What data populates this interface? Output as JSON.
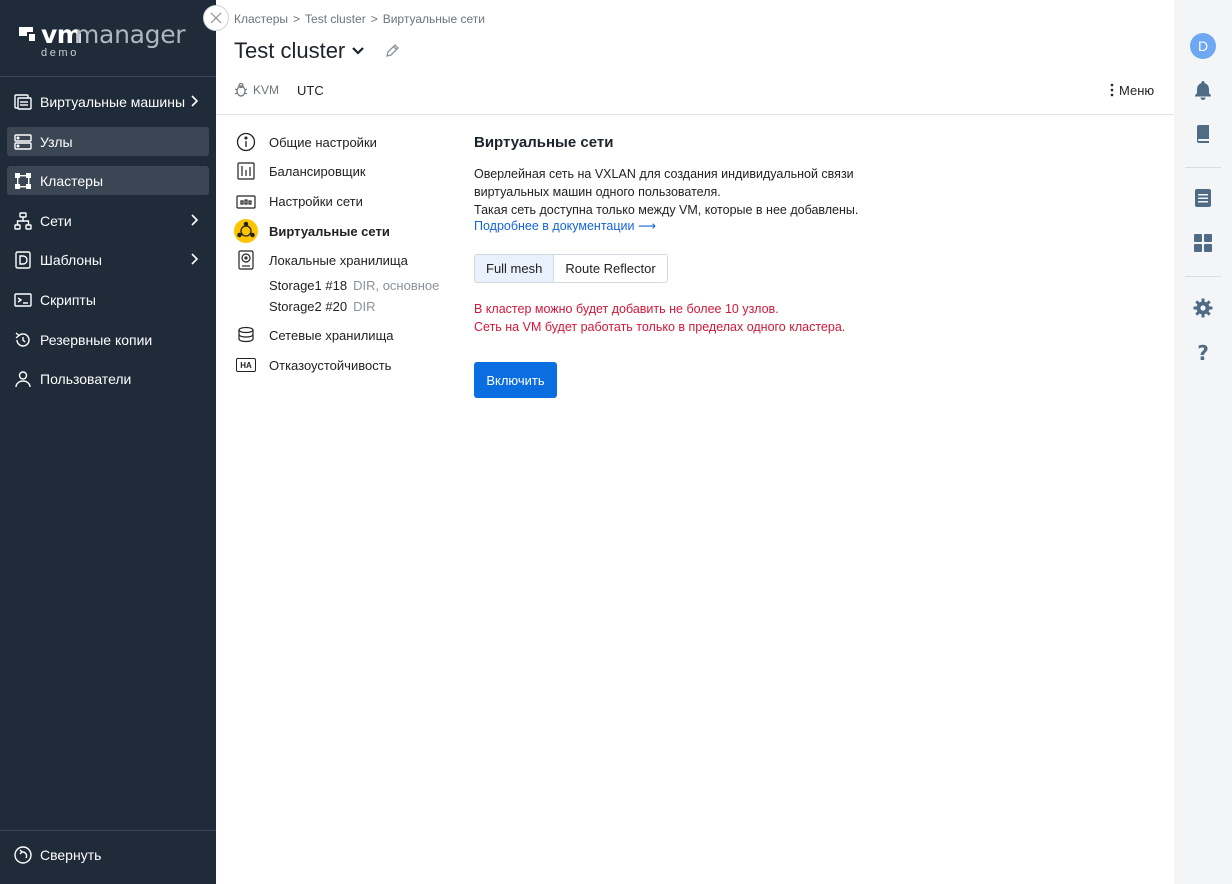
{
  "app": {
    "logo_vm": "vm",
    "logo_manager": "manager",
    "logo_demo": "demo"
  },
  "sidebar": {
    "items": [
      {
        "label": "Виртуальные машины",
        "icon": "vm-icon",
        "has_children": true,
        "active": false
      },
      {
        "label": "Узлы",
        "icon": "nodes-icon",
        "has_children": false,
        "active": true
      },
      {
        "label": "Кластеры",
        "icon": "clusters-icon",
        "has_children": false,
        "active": true
      },
      {
        "label": "Сети",
        "icon": "networks-icon",
        "has_children": true,
        "active": false
      },
      {
        "label": "Шаблоны",
        "icon": "templates-icon",
        "has_children": true,
        "active": false
      },
      {
        "label": "Скрипты",
        "icon": "scripts-icon",
        "has_children": false,
        "active": false
      },
      {
        "label": "Резервные копии",
        "icon": "backup-icon",
        "has_children": false,
        "active": false
      },
      {
        "label": "Пользователи",
        "icon": "user-icon",
        "has_children": false,
        "active": false
      }
    ],
    "collapse_label": "Свернуть"
  },
  "breadcrumb": {
    "items": [
      "Кластеры",
      "Test cluster",
      "Виртуальные сети"
    ],
    "separator": ">"
  },
  "header": {
    "title": "Test cluster",
    "virtualization": "KVM",
    "timezone": "UTC",
    "menu_label": "Меню"
  },
  "settings_menu": {
    "items": [
      {
        "label": "Общие настройки",
        "icon": "info-icon"
      },
      {
        "label": "Балансировщик",
        "icon": "balancer-icon"
      },
      {
        "label": "Настройки сети",
        "icon": "network-settings-icon"
      },
      {
        "label": "Виртуальные сети",
        "icon": "virtual-network-icon",
        "active": true
      },
      {
        "label": "Локальные хранилища",
        "icon": "local-storage-icon"
      },
      {
        "label": "Сетевые хранилища",
        "icon": "network-storage-icon"
      },
      {
        "label": "Отказоустойчивость",
        "icon": "ha-icon"
      }
    ],
    "storages": [
      {
        "name": "Storage1 #18",
        "type": "DIR, основное"
      },
      {
        "name": "Storage2 #20",
        "type": "DIR"
      }
    ],
    "ha_badge": "HA"
  },
  "main": {
    "title": "Виртуальные сети",
    "description_lines": [
      "Оверлейная сеть на VXLAN для создания индивидуальной связи",
      "виртуальных машин одного пользователя.",
      "Такая сеть доступна только между VM, которые в нее добавлены."
    ],
    "doc_link": "Подробнее в документации ⟶",
    "mode_options": [
      "Full mesh",
      "Route Reflector"
    ],
    "mode_selected": "Full mesh",
    "warnings": [
      "В кластер можно будет добавить не более 10 узлов.",
      "Сеть на VM будет работать только в пределах одного кластера."
    ],
    "enable_button": "Включить"
  },
  "right_rail": {
    "avatar_letter": "D",
    "icons": [
      "bell-icon",
      "book-icon",
      "list-icon",
      "dashboard-icon",
      "gear-icon",
      "help-icon"
    ],
    "accent_color": "#6ea8f2",
    "icon_color": "#4f6b85"
  },
  "colors": {
    "sidebar_bg": "#1f2b38",
    "primary": "#0b6ee0",
    "warning": "#d3173a",
    "link": "#1565d8"
  }
}
